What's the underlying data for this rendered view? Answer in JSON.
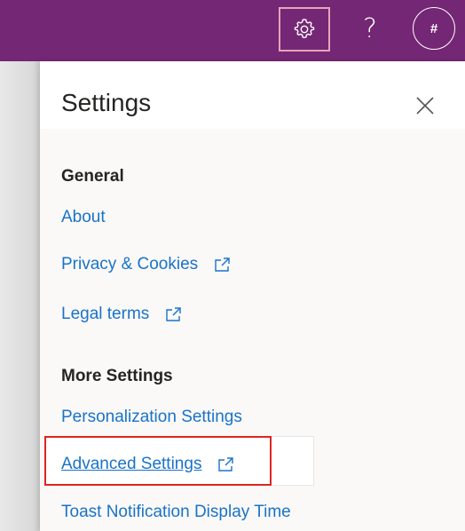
{
  "topbar": {
    "help_label": "?",
    "avatar_initials": "#",
    "color": "#742774"
  },
  "settings_panel": {
    "title": "Settings",
    "sections": [
      {
        "heading": "General",
        "links": [
          {
            "label": "About",
            "external": false
          },
          {
            "label": "Privacy & Cookies",
            "external": true
          },
          {
            "label": "Legal terms",
            "external": true
          }
        ]
      },
      {
        "heading": "More Settings",
        "links": [
          {
            "label": "Personalization Settings",
            "external": false
          },
          {
            "label": "Advanced Settings",
            "external": true,
            "highlighted": true
          },
          {
            "label": "Toast Notification Display Time",
            "external": false
          }
        ]
      }
    ]
  },
  "colors": {
    "link": "#1a73c8",
    "panel_bg": "#faf9f8",
    "highlight_border": "#e0241f"
  }
}
